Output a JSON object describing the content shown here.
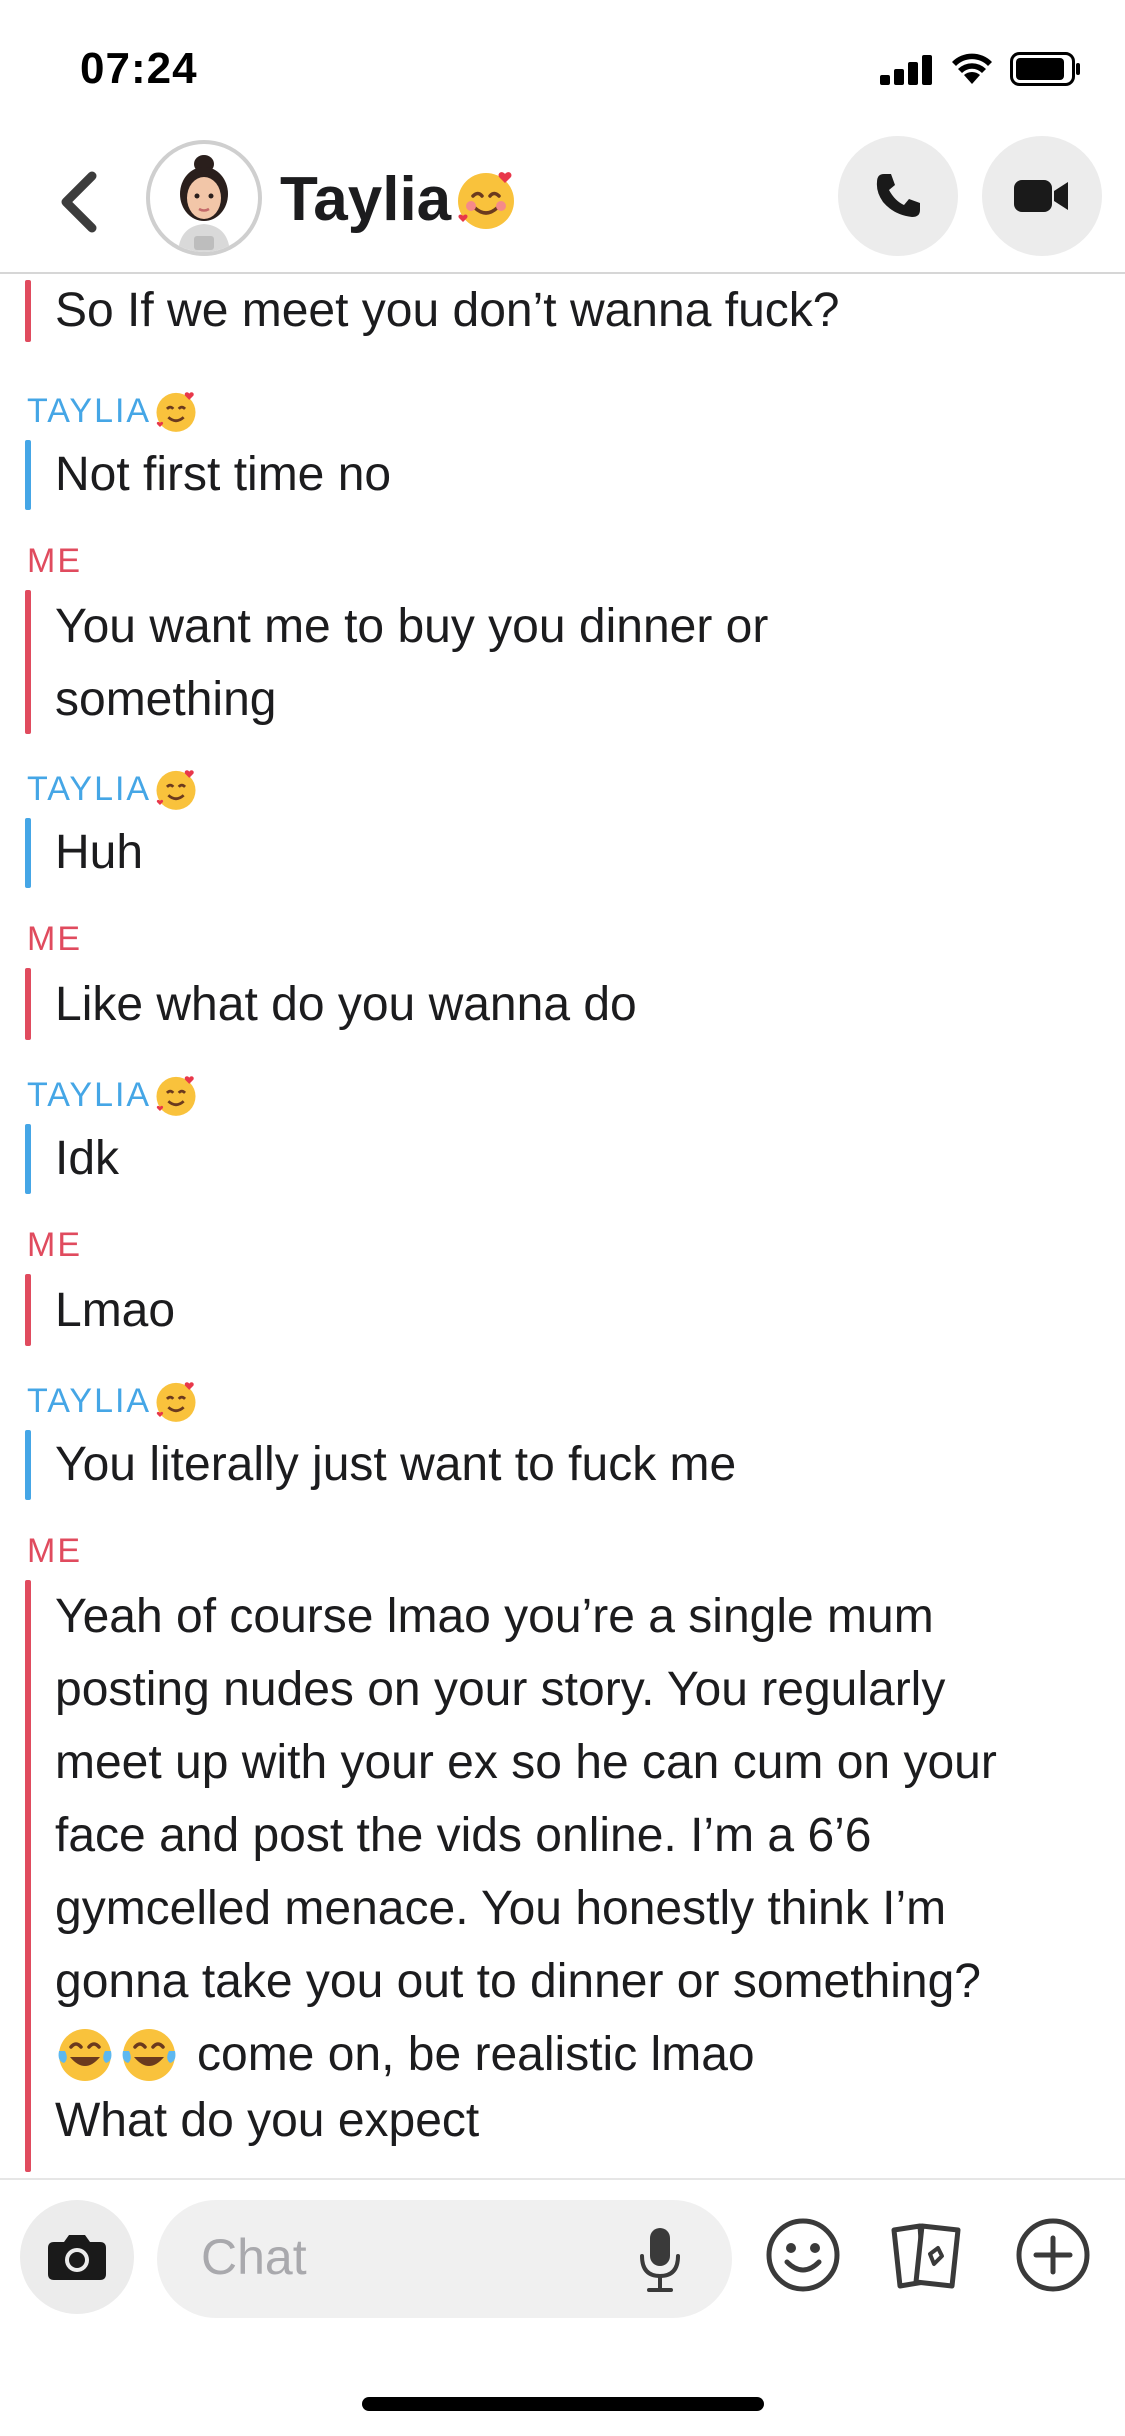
{
  "status_bar": {
    "time": "07:24"
  },
  "header": {
    "contact_name": "Taylia",
    "back_label": "‹"
  },
  "senders": {
    "me": "ME",
    "them": "TAYLIA"
  },
  "messages": [
    {
      "sender": "me",
      "text": "So If we meet you don’t wanna fuck?"
    },
    {
      "sender": "them",
      "text": "Not first time no"
    },
    {
      "sender": "me",
      "text": "You want me to buy you dinner or\nsomething"
    },
    {
      "sender": "them",
      "text": "Huh"
    },
    {
      "sender": "me",
      "text": "Like what do you wanna do"
    },
    {
      "sender": "them",
      "text": "Idk"
    },
    {
      "sender": "me",
      "text": "Lmao"
    },
    {
      "sender": "them",
      "text": "You literally just want to fuck me"
    },
    {
      "sender": "me",
      "text": "Yeah of course lmao you’re a single mum\nposting nudes on your story. You regularly\nmeet up with your ex so he can cum on your\nface and post the vids online. I’m a 6’6\ngymcelled menace. You honestly think I’m\ngonna take you out to dinner or something?",
      "tail": "come on, be realistic lmao",
      "last_line": "What do you expect"
    }
  ],
  "input": {
    "placeholder": "Chat"
  },
  "icons": {
    "back": "chevron-left-icon",
    "call": "phone-icon",
    "video": "video-camera-icon",
    "camera": "camera-icon",
    "mic": "microphone-icon",
    "emoji": "smiley-icon",
    "stickers": "sticker-cards-icon",
    "plus": "plus-circle-icon",
    "name_emoji": "smiling-face-with-hearts-icon",
    "laugh_emoji": "tears-of-joy-icon"
  },
  "colors": {
    "me": "#e04b5e",
    "them": "#45a6e6",
    "text": "#1c1c1e",
    "placeholder": "#a9a9ad",
    "button_bg": "#ececec"
  }
}
